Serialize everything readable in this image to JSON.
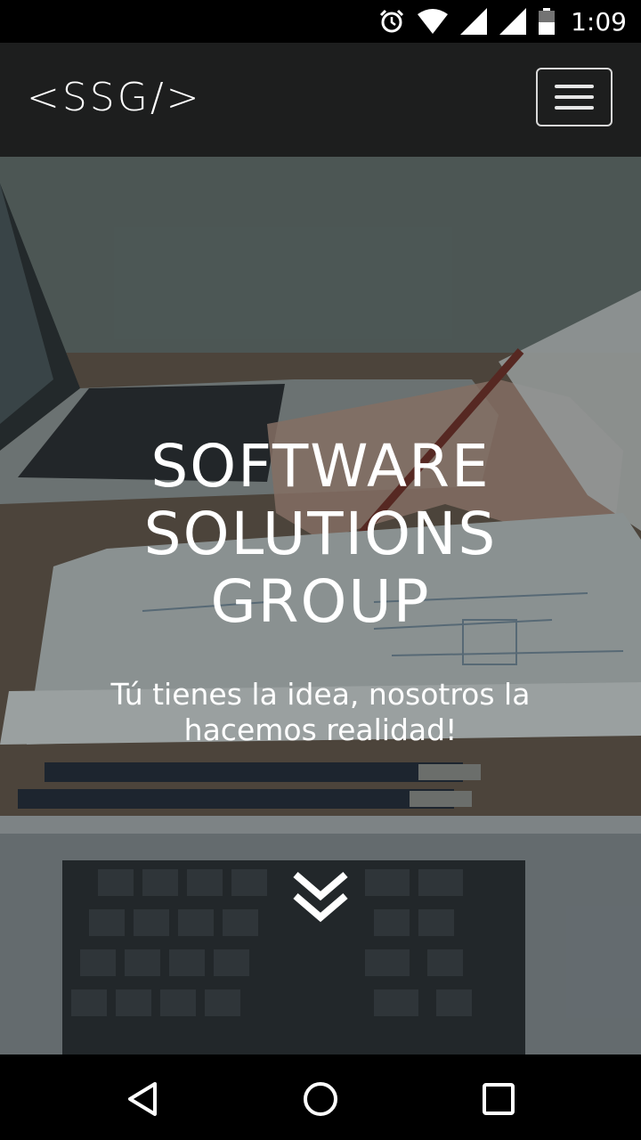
{
  "status_bar": {
    "time": "1:09",
    "icons": [
      "alarm-icon",
      "wifi-icon",
      "signal-icon",
      "signal-icon",
      "battery-icon"
    ]
  },
  "navbar": {
    "logo": "<SSG/>",
    "menu_icon": "hamburger-icon"
  },
  "hero": {
    "title_lines": [
      "SOFTWARE",
      "SOLUTIONS",
      "GROUP"
    ],
    "subtitle": "Tú tienes la idea, nosotros la hacemos realidad!",
    "scroll_icon": "double-chevron-down-icon"
  },
  "system_nav": {
    "buttons": [
      "back-icon",
      "home-icon",
      "recents-icon"
    ]
  }
}
